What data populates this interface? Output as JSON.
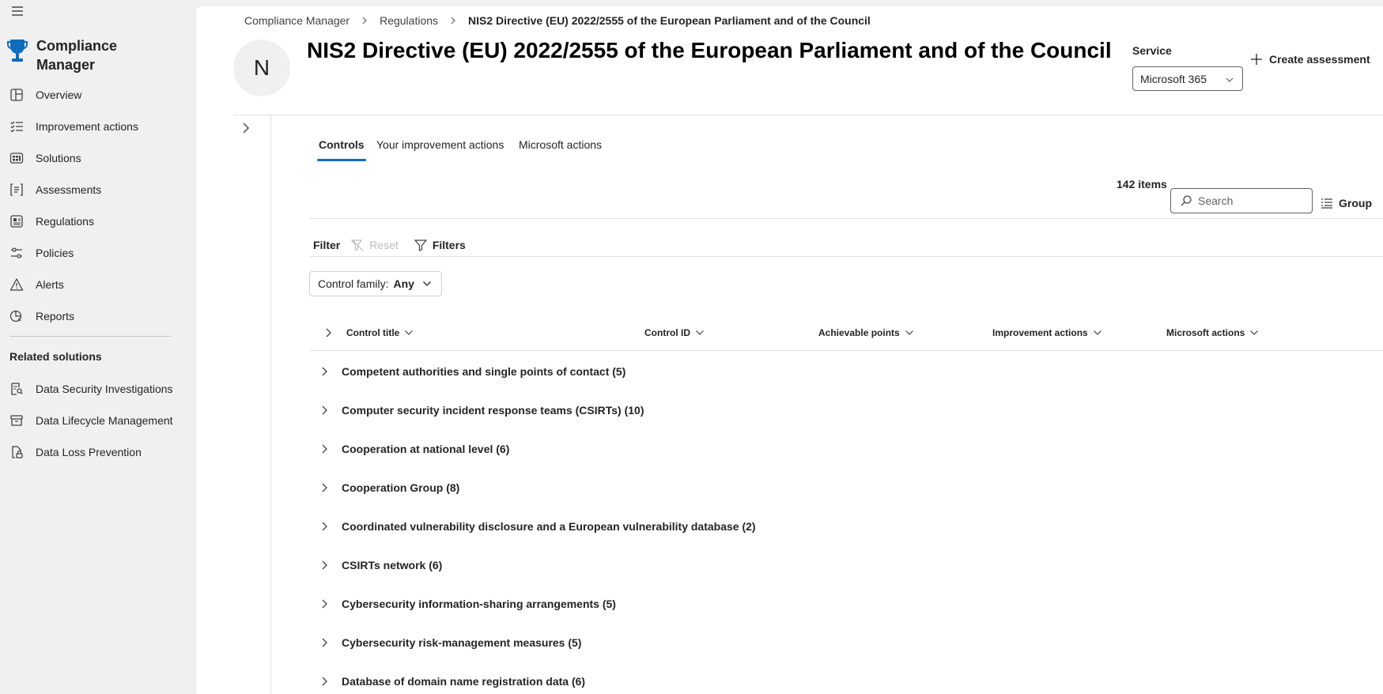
{
  "app": {
    "title_line1": "Compliance",
    "title_line2": "Manager"
  },
  "sidebar": {
    "items": [
      {
        "label": "Overview",
        "icon": "overview-icon"
      },
      {
        "label": "Improvement actions",
        "icon": "list-checks-icon"
      },
      {
        "label": "Solutions",
        "icon": "solutions-icon"
      },
      {
        "label": "Assessments",
        "icon": "assessments-icon"
      },
      {
        "label": "Regulations",
        "icon": "regulations-icon"
      },
      {
        "label": "Policies",
        "icon": "policies-icon"
      },
      {
        "label": "Alerts",
        "icon": "alert-icon"
      },
      {
        "label": "Reports",
        "icon": "reports-icon"
      }
    ],
    "related_title": "Related solutions",
    "related": [
      {
        "label": "Data Security Investigations",
        "icon": "investigation-icon"
      },
      {
        "label": "Data Lifecycle Management",
        "icon": "archive-icon"
      },
      {
        "label": "Data Loss Prevention",
        "icon": "document-lock-icon"
      }
    ]
  },
  "breadcrumb": {
    "items": [
      "Compliance Manager",
      "Regulations"
    ],
    "current": "NIS2 Directive (EU) 2022/2555 of the European Parliament and of the Council"
  },
  "header": {
    "avatar_letter": "N",
    "title": "NIS2 Directive (EU) 2022/2555 of the European Parliament and of the Council",
    "service_label": "Service",
    "service_value": "Microsoft 365",
    "create_label": "Create assessment"
  },
  "tabs": [
    {
      "label": "Controls",
      "active": true
    },
    {
      "label": "Your improvement actions",
      "active": false
    },
    {
      "label": "Microsoft actions",
      "active": false
    }
  ],
  "toolbar": {
    "items_count": "142 items",
    "search_placeholder": "Search",
    "group_label": "Group"
  },
  "filter": {
    "label": "Filter",
    "reset_label": "Reset",
    "filters_label": "Filters",
    "pill_label": "Control family:",
    "pill_value": "Any"
  },
  "table": {
    "columns": [
      "Control title",
      "Control ID",
      "Achievable points",
      "Improvement actions",
      "Microsoft actions"
    ],
    "rows": [
      "Competent authorities and single points of contact (5)",
      "Computer security incident response teams (CSIRTs) (10)",
      "Cooperation at national level (6)",
      "Cooperation Group (8)",
      "Coordinated vulnerability disclosure and a European vulnerability database (2)",
      "CSIRTs network (6)",
      "Cybersecurity information-sharing arrangements (5)",
      "Cybersecurity risk-management measures (5)",
      "Database of domain name registration data (6)"
    ]
  },
  "colors": {
    "accent": "#0f6cbd",
    "brand_icon": "#0f6cbd"
  }
}
